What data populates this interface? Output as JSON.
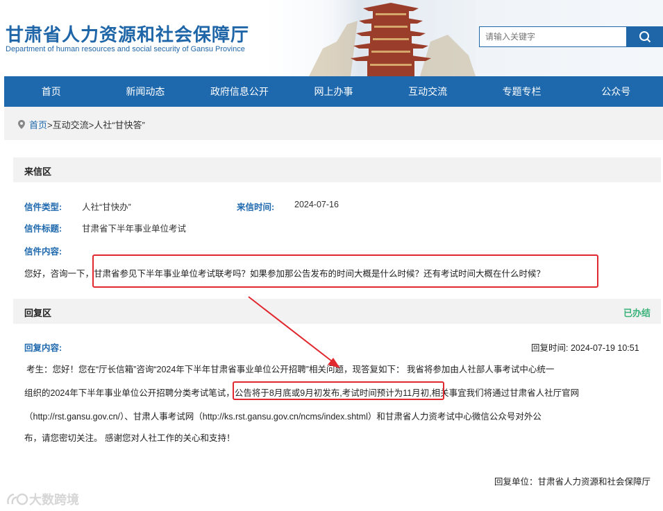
{
  "header": {
    "title": "甘肃省人力资源和社会保障厅",
    "subtitle": "Department of human resources and social security of Gansu Province",
    "search_placeholder": "请输入关键字"
  },
  "nav": [
    "首页",
    "新闻动态",
    "政府信息公开",
    "网上办事",
    "互动交流",
    "专题专栏",
    "公众号"
  ],
  "breadcrumb": {
    "home": "首页",
    "rest": ">互动交流>人社“甘快答”"
  },
  "letter": {
    "section_title": "来信区",
    "type_label": "信件类型:",
    "type_value": "人社“甘快办”",
    "time_label": "来信时间:",
    "time_value": "2024-07-16",
    "subject_label": "信件标题:",
    "subject_value": "甘肃省下半年事业单位考试",
    "content_label": "信件内容:",
    "content": "您好，咨询一下，甘肃省参见下半年事业单位考试联考吗？如果参加那公告发布的时间大概是什么时候？还有考试时间大概在什么时候？"
  },
  "reply": {
    "section_title": "回复区",
    "status": "已办结",
    "content_label": "回复内容:",
    "time_label": "回复时间:",
    "time_value": "2024-07-19 10:51",
    "line1": "考生：您好！您在“厅长信箱”咨询“2024年下半年甘肃省事业单位公开招聘”相关问题，现答复如下：  我省将参加由人社部人事考试中心统一",
    "line2a": "组织的2024年下半年事业单位公开招聘分类考试笔试，",
    "line2b": "公告将于8月底或9月初发布,考试时间预计为11月初,",
    "line2c": "相关事宜我们将通过甘肃省人社厅官网",
    "line3": "（http://rst.gansu.gov.cn/）、甘肃人事考试网（http://ks.rst.gansu.gov.cn/ncms/index.shtml）和甘肃省人力资考试中心微信公众号对外公",
    "line4": "布，请您密切关注。 感谢您对人社工作的关心和支持！",
    "unit": "回复单位：甘肃省人力资源和社会保障厅"
  },
  "watermark": "大数跨境",
  "colors": {
    "brand": "#1e68ad",
    "highlight": "#e0282e",
    "status": "#3bb27a"
  }
}
